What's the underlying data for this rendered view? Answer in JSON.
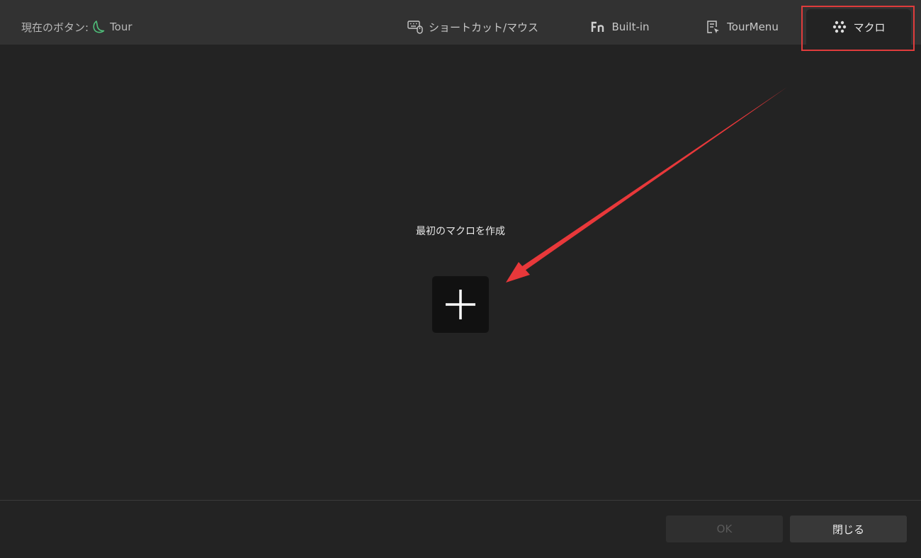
{
  "header": {
    "current_button_label": "現在のボタン:",
    "current_button_value": "Tour",
    "tabs": [
      {
        "id": "shortcut",
        "label": "ショートカット/マウス",
        "icon": "keyboard-mouse-icon",
        "active": false
      },
      {
        "id": "builtin",
        "label": "Built-in",
        "icon": "fn-icon",
        "active": false
      },
      {
        "id": "tourmenu",
        "label": "TourMenu",
        "icon": "menu-edit-icon",
        "active": false
      },
      {
        "id": "macro",
        "label": "マクロ",
        "icon": "dots-cluster-icon",
        "active": true
      }
    ]
  },
  "main": {
    "empty_title": "最初のマクロを作成",
    "add_icon": "plus-icon"
  },
  "footer": {
    "ok_label": "OK",
    "close_label": "閉じる"
  },
  "colors": {
    "background": "#232323",
    "header": "#323232",
    "accent_green": "#4fbf7a",
    "annotation_red": "#e03c3c"
  }
}
